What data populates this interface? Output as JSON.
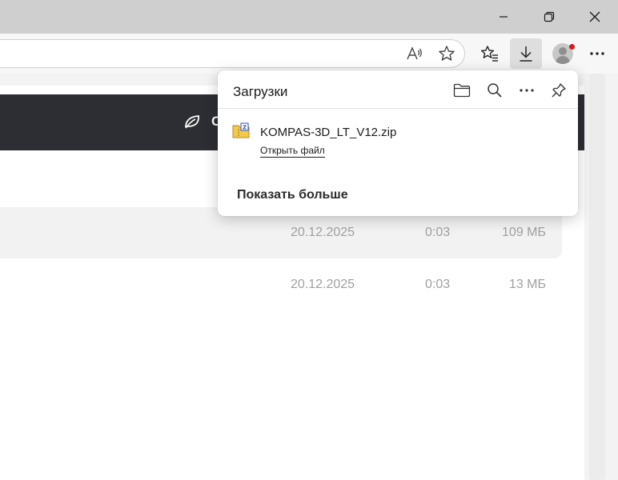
{
  "window_controls": {
    "minimize": "minimize",
    "maximize": "restore",
    "close": "close"
  },
  "toolbar": {
    "icons": [
      "read-aloud-icon",
      "add-favorite-icon",
      "favorites-icon",
      "downloads-icon",
      "profile-icon",
      "more-icon"
    ],
    "profile_notification_color": "#d21c1c"
  },
  "page": {
    "banner_text": "С",
    "rows": [
      {
        "date": "20.12.2025",
        "time": "0:03",
        "size": "109 МБ"
      },
      {
        "date": "20.12.2025",
        "time": "0:03",
        "size": "13 МБ"
      }
    ]
  },
  "downloads": {
    "title": "Загрузки",
    "actions": [
      "folder-icon",
      "search-icon",
      "more-icon",
      "pin-icon"
    ],
    "items": [
      {
        "filename": "KOMPAS-3D_LT_V12.zip",
        "action_label": "Открыть файл"
      }
    ],
    "show_more_label": "Показать больше"
  },
  "colors": {
    "titlebar": "#cfcfcf",
    "banner": "#2d2e33",
    "download_button_active": "#dedede"
  }
}
